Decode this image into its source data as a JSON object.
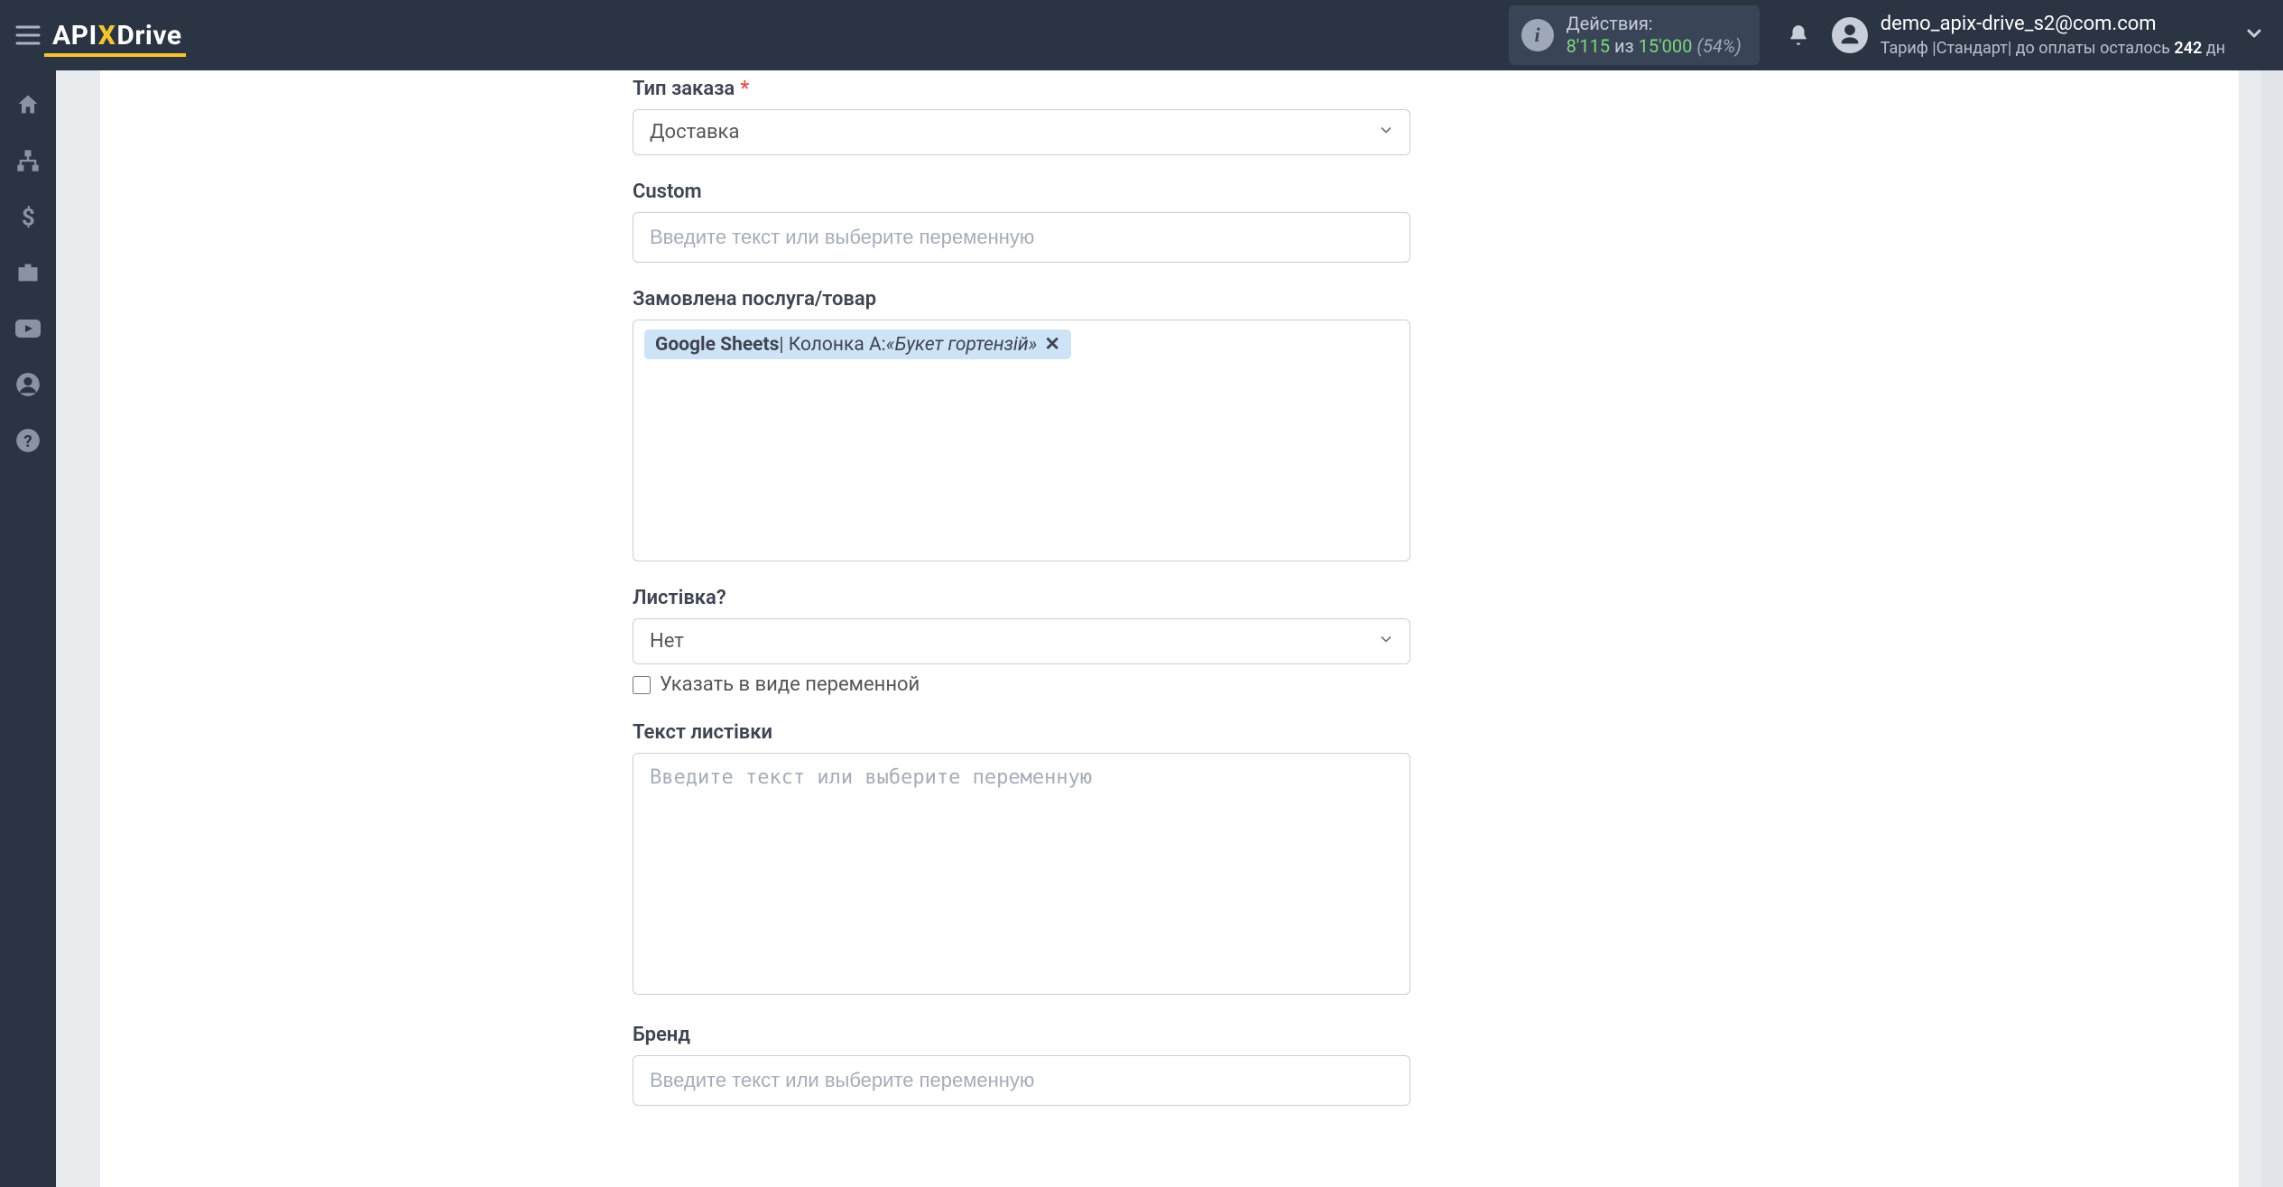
{
  "header": {
    "logo_parts": {
      "pre": "API",
      "x": "X",
      "post": "Drive"
    },
    "actions": {
      "label": "Действия:",
      "used": "8'115",
      "of_word": "из",
      "total": "15'000",
      "pct": "(54%)"
    },
    "user": {
      "email": "demo_apix-drive_s2@com.com",
      "tariff_prefix": "Тариф |Стандарт| до оплаты осталось ",
      "days": "242",
      "days_suffix": " дн"
    }
  },
  "form": {
    "order_type": {
      "label": "Тип заказа",
      "required": "*",
      "value": "Доставка"
    },
    "custom": {
      "label": "Custom",
      "placeholder": "Введите текст или выберите переменную"
    },
    "ordered_item": {
      "label": "Замовлена послуга/товар",
      "tag": {
        "bold": "Google Sheets",
        "sep": " | Колонка A: ",
        "ital": "«Букет гортензій»",
        "close": "✕"
      }
    },
    "postcard": {
      "label": "Листівка?",
      "value": "Нет"
    },
    "postcard_checkbox": {
      "label": "Указать в виде переменной"
    },
    "postcard_text": {
      "label": "Текст листівки",
      "placeholder": "Введите текст или выберите переменную"
    },
    "brand": {
      "label": "Бренд",
      "placeholder": "Введите текст или выберите переменную"
    }
  }
}
